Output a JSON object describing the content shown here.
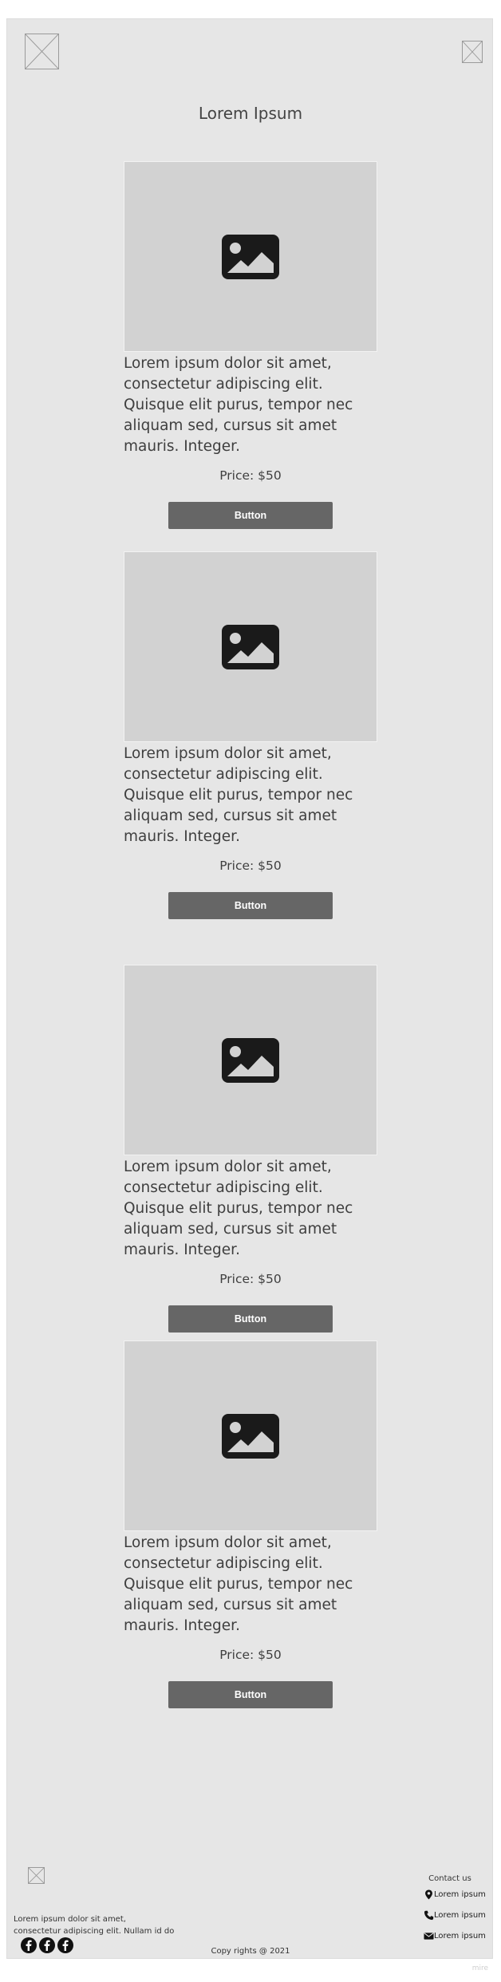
{
  "header": {
    "logo_icon": "image-placeholder-icon",
    "menu_icon": "image-placeholder-icon",
    "title": "Lorem Ipsum"
  },
  "products": [
    {
      "image_icon": "image-icon",
      "description": "Lorem ipsum dolor sit amet, consectetur adipiscing elit. Quisque elit purus, tempor nec aliquam sed, cursus sit amet mauris. Integer.",
      "price": "Price: $50",
      "button_label": "Button"
    },
    {
      "image_icon": "image-icon",
      "description": "Lorem ipsum dolor sit amet, consectetur adipiscing elit. Quisque elit purus, tempor nec aliquam sed, cursus sit amet mauris. Integer.",
      "price": "Price: $50",
      "button_label": "Button"
    },
    {
      "image_icon": "image-icon",
      "description": "Lorem ipsum dolor sit amet, consectetur adipiscing elit. Quisque elit purus, tempor nec aliquam sed, cursus sit amet mauris. Integer.",
      "price": "Price: $50",
      "button_label": "Button"
    },
    {
      "image_icon": "image-icon",
      "description": "Lorem ipsum dolor sit amet, consectetur adipiscing elit. Quisque elit purus, tempor nec aliquam sed, cursus sit amet mauris. Integer.",
      "price": "Price: $50",
      "button_label": "Button"
    }
  ],
  "footer": {
    "logo_icon": "image-placeholder-icon",
    "about_line1": "Lorem ipsum dolor sit amet,",
    "about_line2": "consectetur adipiscing elit. Nullam id do",
    "social_icons": [
      "facebook-icon",
      "facebook-icon",
      "facebook-icon"
    ],
    "copyright": "Copy rights @ 2021",
    "contact_title": "Contact us",
    "contacts": [
      {
        "icon": "location-pin-icon",
        "label": "Lorem ipsum"
      },
      {
        "icon": "phone-icon",
        "label": "Lorem ipsum"
      },
      {
        "icon": "mail-icon",
        "label": "Lorem ipsum"
      }
    ]
  },
  "watermark": "mire",
  "colors": {
    "frame_background": "#e6e6e6",
    "image_placeholder": "#d2d2d2",
    "button": "#666666",
    "button_text": "#ffffff"
  }
}
